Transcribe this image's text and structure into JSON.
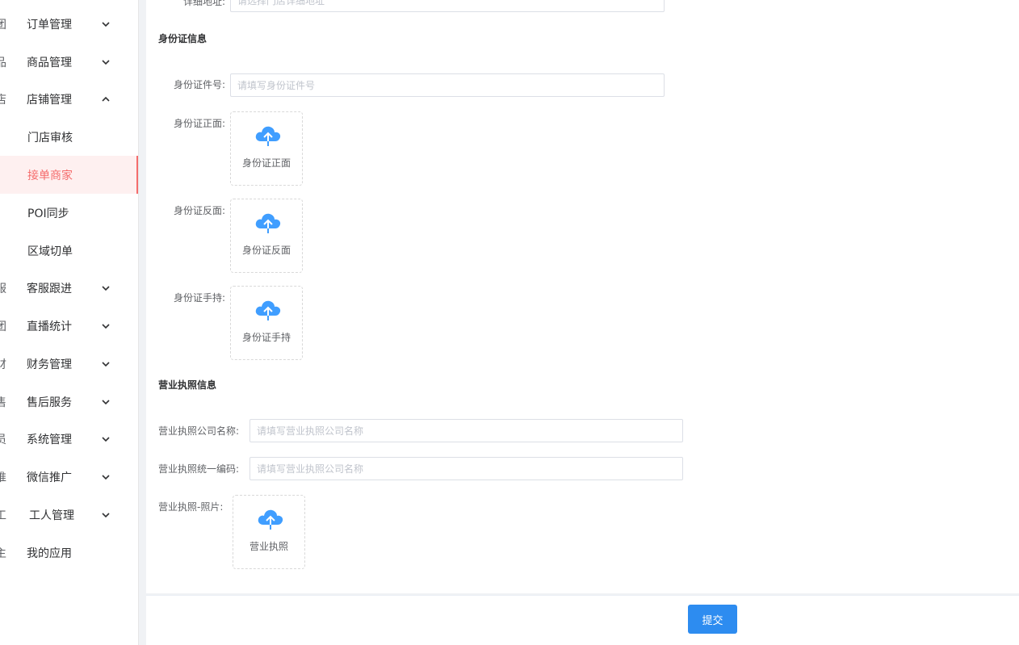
{
  "sidebar": {
    "items": [
      {
        "glyph": "团",
        "label": "订单管理",
        "arrow": "down"
      },
      {
        "glyph": "品",
        "label": "商品管理",
        "arrow": "down"
      },
      {
        "glyph": "店",
        "label": "店铺管理",
        "arrow": "up"
      },
      {
        "glyph": "",
        "label": "门店审核",
        "arrow": ""
      },
      {
        "glyph": "",
        "label": "接单商家",
        "arrow": "",
        "active": true
      },
      {
        "glyph": "",
        "label": "POI同步",
        "arrow": ""
      },
      {
        "glyph": "",
        "label": "区域切单",
        "arrow": ""
      },
      {
        "glyph": "服",
        "label": "客服跟进",
        "arrow": "down"
      },
      {
        "glyph": "团",
        "label": "直播统计",
        "arrow": "down"
      },
      {
        "glyph": "财",
        "label": "财务管理",
        "arrow": "down"
      },
      {
        "glyph": "售",
        "label": "售后服务",
        "arrow": "down"
      },
      {
        "glyph": "员",
        "label": "系统管理",
        "arrow": "down"
      },
      {
        "glyph": "推",
        "label": "微信推广",
        "arrow": "down"
      },
      {
        "glyph": "工",
        "label": "工人管理",
        "arrow": "down"
      },
      {
        "glyph": "主",
        "label": "我的应用",
        "arrow": ""
      }
    ],
    "colors": {
      "active": "#f56c6c",
      "active_bg": "#fef0f0"
    }
  },
  "form": {
    "address": {
      "label": "详细地址:",
      "placeholder": "请选择门店详细地址"
    },
    "id_section": {
      "title": "身份证信息",
      "id_number": {
        "label": "身份证件号:",
        "placeholder": "请填写身份证件号"
      },
      "front": {
        "label": "身份证正面:",
        "upload_text": "身份证正面"
      },
      "back": {
        "label": "身份证反面:",
        "upload_text": "身份证反面"
      },
      "handheld": {
        "label": "身份证手持:",
        "upload_text": "身份证手持"
      }
    },
    "license_section": {
      "title": "营业执照信息",
      "company_name": {
        "label": "营业执照公司名称:",
        "placeholder": "请填写营业执照公司名称"
      },
      "unified_code": {
        "label": "营业执照统一编码:",
        "placeholder": "请填写营业执照公司名称"
      },
      "photo": {
        "label": "营业执照-照片:",
        "upload_text": "营业执照"
      }
    }
  },
  "footer": {
    "submit_label": "提交"
  },
  "icons": {
    "upload": "cloud-upload-icon",
    "chevron_down": "chevron-down-icon",
    "chevron_up": "chevron-up-icon"
  },
  "colors": {
    "primary": "#2d8cf0",
    "upload_icon": "#409eff"
  }
}
